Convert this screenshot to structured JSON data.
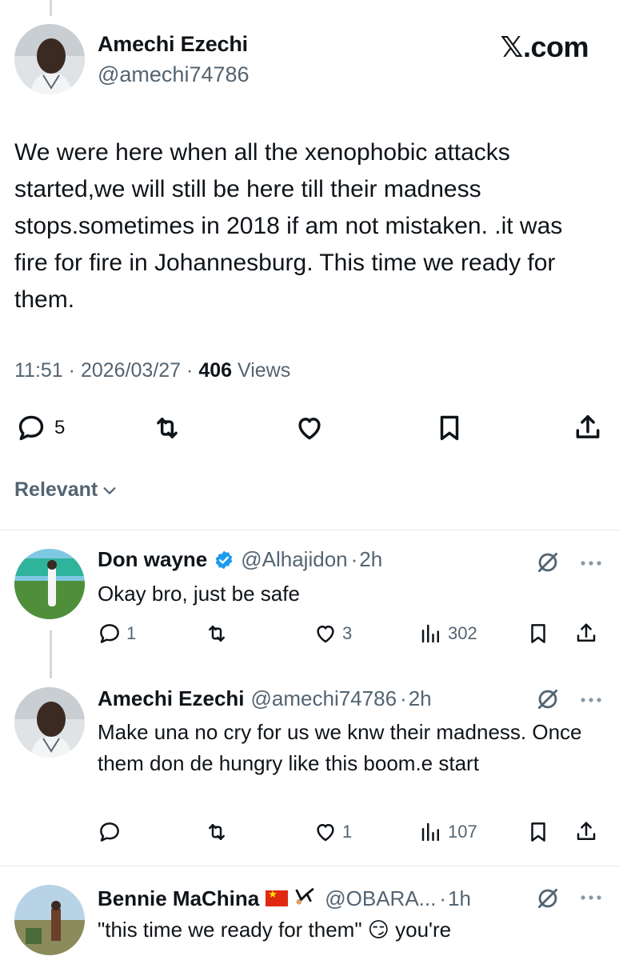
{
  "main_tweet": {
    "author_name": "Amechi Ezechi",
    "author_handle": "@amechi74786",
    "brand": "𝕏.com",
    "text": "We were here when all the xenophobic attacks started,we will still be here till their madness stops.sometimes in 2018 if am not mistaken. .it was fire for fire in Johannesburg. This time we ready for them.",
    "time": "11:51",
    "date": "2026/03/27",
    "views_count": "406",
    "views_label": "Views",
    "reply_count": "5",
    "icons": [
      "reply-icon",
      "retweet-icon",
      "like-icon",
      "bookmark-icon",
      "share-icon"
    ]
  },
  "sort": {
    "label": "Relevant"
  },
  "replies": [
    {
      "author_name": "Don wayne",
      "author_handle": "@Alhajidon",
      "age": "2h",
      "verified": true,
      "text": "Okay bro, just be safe",
      "reply_count": "1",
      "retweet_count": "",
      "like_count": "3",
      "view_count": "302"
    },
    {
      "author_name": "Amechi Ezechi",
      "author_handle": "@amechi74786",
      "age": "2h",
      "verified": false,
      "text": "Make una no cry for us we knw their madness. Once them don de hungry like this boom.e start",
      "reply_count": "",
      "retweet_count": "",
      "like_count": "1",
      "view_count": "107"
    },
    {
      "author_name": "Bennie MaChina",
      "author_handle": "@OBARA...",
      "age": "1h",
      "verified": false,
      "text": "\"this time we ready for them\" 😏 you're"
    }
  ],
  "separator": "·",
  "colors": {
    "text_primary": "#0f1419",
    "text_secondary": "#536471",
    "verified_blue": "#1d9bf0",
    "divider": "#e4e8eb"
  }
}
